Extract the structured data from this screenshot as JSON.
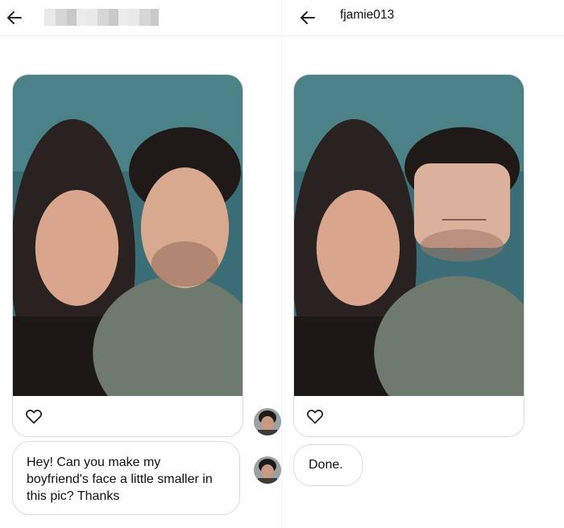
{
  "left_panel": {
    "header": {
      "back_icon": "arrow-left-icon",
      "username_redacted": true
    },
    "photo_message": {
      "like_icon": "heart-outline-icon"
    },
    "text_message": {
      "text": "Hey! Can you make my boyfriend's face a little smaller in this pic? Thanks"
    }
  },
  "right_panel": {
    "header": {
      "back_icon": "arrow-left-icon",
      "username": "fjamie013"
    },
    "photo_message": {
      "like_icon": "heart-outline-icon"
    },
    "text_message": {
      "text": "Done."
    }
  },
  "colors": {
    "bubble_border": "#dbdbdb",
    "text": "#111111",
    "background": "#ffffff"
  }
}
